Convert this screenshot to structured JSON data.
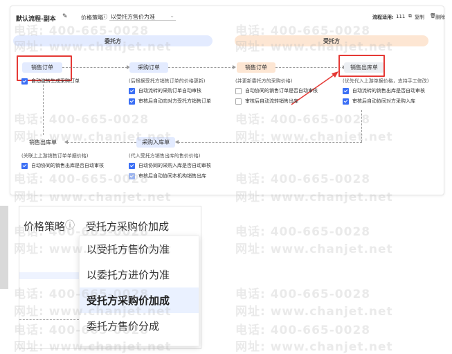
{
  "header": {
    "title": "默认流程-副本",
    "strategy_label": "价格策略",
    "strategy_value": "以受托方售价为准",
    "apply_label": "流程适用:",
    "apply_count": "111",
    "copy_label": "复制",
    "delete_label": "删除"
  },
  "bands": {
    "left": "委托方",
    "right": "受托方"
  },
  "nodes": {
    "n1": "销售订单",
    "n2": "采购订单",
    "n3": "销售订单",
    "n4": "销售出库单",
    "n5": "销售出库单",
    "n6": "采购入库单"
  },
  "desc": {
    "n2": "(后根据受托方销售订单的价格更新)",
    "n3": "(并更新委托方的采购价格)",
    "n4": "(优先代入上游单据价格，支持手工修改)",
    "n5": "(关联上上游销售订单单据价格)",
    "n6": "(代入受托方销售出库的售价价格)"
  },
  "checks": {
    "n1": [
      {
        "label": "自动流转生成采购订单",
        "checked": true
      }
    ],
    "n2": [
      {
        "label": "自动流转的采购订单自动审核",
        "checked": true
      },
      {
        "label": "审核后自动向对方受托方销售订单",
        "checked": true
      }
    ],
    "n3": [
      {
        "label": "自动协同的销售订单是否自动审核",
        "checked": false
      },
      {
        "label": "审核后自动流转销售出库",
        "checked": false
      }
    ],
    "n4": [
      {
        "label": "自动流转的销售出库是否自动审核",
        "checked": true
      },
      {
        "label": "审核后自动协同对方采购入库",
        "checked": true
      }
    ],
    "n5": [
      {
        "label": "自动协同的销售出库是否自动审核",
        "checked": true
      }
    ],
    "n6": [
      {
        "label": "自动协同的采购入库是否自动审核",
        "checked": true
      },
      {
        "label": "审核后自动协同本机构销售出库",
        "checked": true
      }
    ]
  },
  "zoom": {
    "strategy_label": "价格策略",
    "strategy_value": "受托方采购价加成",
    "options": [
      "以受托方售价为准",
      "以委托方进价为准",
      "受托方采购价加成",
      "委托方售价分成"
    ],
    "selected_index": 2
  },
  "watermark": {
    "phone": "电话: 400-665-0028",
    "site": "网址: www.chanjet.net"
  },
  "colors": {
    "accent": "#3b6ff5",
    "highlight": "#e53935",
    "client_band": "#e3ebff",
    "trustee_band": "#fde6d3"
  }
}
